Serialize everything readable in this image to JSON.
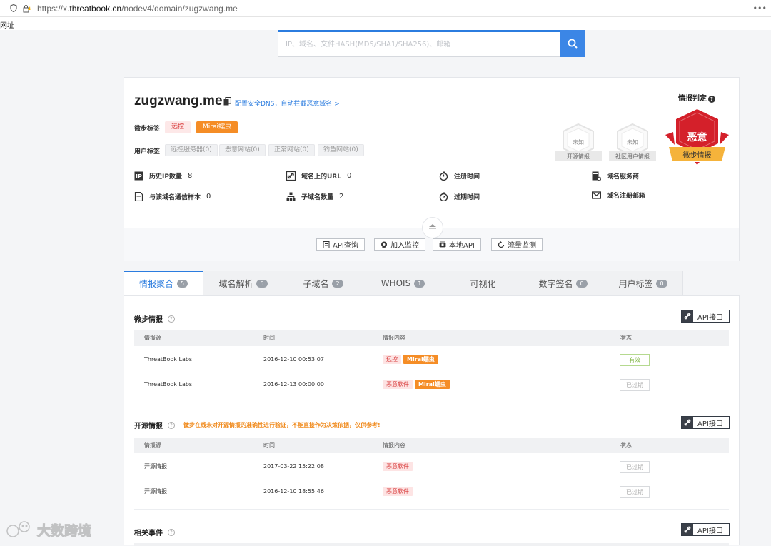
{
  "browser": {
    "url_prefix": "https://x.",
    "url_host": "threatbook.cn",
    "url_path": "/nodev4/domain/zugzwang.me",
    "bookmark": "网址"
  },
  "search": {
    "placeholder": "IP、域名、文件HASH(MD5/SHA1/SHA256)、邮箱"
  },
  "domain": {
    "name": "zugzwang.me",
    "dns_link": "配置安全DNS，自动拦截恶意域名 >"
  },
  "tags": {
    "micro_label": "微步标签",
    "micro": [
      "远控",
      "Mirai蠕虫"
    ],
    "user_label": "用户标签",
    "user": [
      "远控服务器(0)",
      "恶意网站(0)",
      "正常网站(0)",
      "钓鱼网站(0)"
    ]
  },
  "stats": {
    "history_ip": {
      "label": "历史IP数量",
      "value": "8"
    },
    "domain_url": {
      "label": "域名上的URL",
      "value": "0"
    },
    "reg_time": {
      "label": "注册时间"
    },
    "registrar": {
      "label": "域名服务商"
    },
    "comm_samples": {
      "label": "与该域名通信样本",
      "value": "0"
    },
    "subdomain_count": {
      "label": "子域名数量",
      "value": "2"
    },
    "expire_time": {
      "label": "过期时间"
    },
    "reg_email": {
      "label": "域名注册邮箱"
    }
  },
  "verdict": {
    "title": "情报判定",
    "open_source": {
      "state": "未知",
      "label": "开源情报"
    },
    "community": {
      "state": "未知",
      "label": "社区用户情报"
    },
    "threatbook": {
      "state": "恶意",
      "label": "微步情报"
    },
    "colors": {
      "malicious": "#d4202a",
      "ribbon": "#f5b33b"
    }
  },
  "actions": [
    "API查询",
    "加入监控",
    "本地API",
    "流量监测"
  ],
  "tabs": [
    {
      "label": "情报聚合",
      "count": "5"
    },
    {
      "label": "域名解析",
      "count": "5"
    },
    {
      "label": "子域名",
      "count": "2"
    },
    {
      "label": "WHOIS",
      "count": "1"
    },
    {
      "label": "可视化",
      "count": ""
    },
    {
      "label": "数字签名",
      "count": "0"
    },
    {
      "label": "用户标签",
      "count": "0"
    }
  ],
  "sections": {
    "micro": {
      "title": "微步情报",
      "api": "API接口",
      "headers": [
        "情报源",
        "时间",
        "情报内容",
        "状态"
      ],
      "rows": [
        {
          "source": "ThreatBook Labs",
          "time": "2016-12-10 00:53:07",
          "tags": [
            "远控",
            "Mirai蠕虫"
          ],
          "status": "有效"
        },
        {
          "source": "ThreatBook Labs",
          "time": "2016-12-13 00:00:00",
          "tags": [
            "恶意软件",
            "Mirai蠕虫"
          ],
          "status": "已过期"
        }
      ]
    },
    "open": {
      "title": "开源情报",
      "warning": "微步在线未对开源情报的准确性进行验证，不能直接作为决策依据，仅供参考!",
      "api": "API接口",
      "headers": [
        "情报源",
        "时间",
        "情报内容",
        "状态"
      ],
      "rows": [
        {
          "source": "开源情报",
          "time": "2017-03-22 15:22:08",
          "tags": [
            "恶意软件"
          ],
          "status": "已过期"
        },
        {
          "source": "开源情报",
          "time": "2016-12-10 18:55:46",
          "tags": [
            "恶意软件"
          ],
          "status": "已过期"
        }
      ]
    },
    "events": {
      "title": "相关事件",
      "api": "API接口"
    }
  },
  "watermark": "大数跨境"
}
